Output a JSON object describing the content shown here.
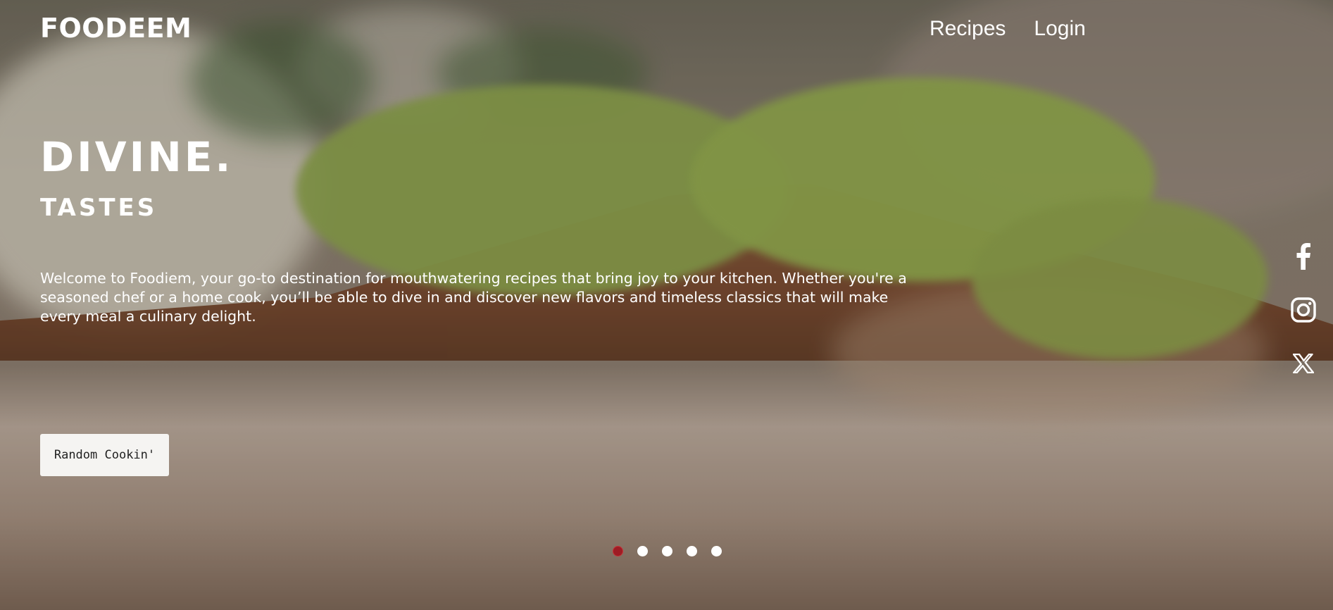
{
  "brand": {
    "name": "FOODEEM"
  },
  "nav": {
    "recipes": "Recipes",
    "login": "Login"
  },
  "hero": {
    "headline": "DIVINE.",
    "subheadline": "TASTES",
    "intro": "Welcome to Foodiem, your go-to destination for mouthwatering recipes that bring joy to your kitchen. Whether you're a seasoned chef or a home cook, you’ll be able to dive in and discover new flavors and timeless classics that will make every meal a culinary delight.",
    "button_label": "Random Cookin'"
  },
  "social": [
    {
      "icon": "facebook-icon"
    },
    {
      "icon": "instagram-icon"
    },
    {
      "icon": "x-twitter-icon"
    }
  ],
  "slider": {
    "count": 5,
    "active_index": 0
  },
  "colors": {
    "active_dot": "#9e1c24",
    "button_bg": "#f5f4f2",
    "text": "#ffffff"
  }
}
